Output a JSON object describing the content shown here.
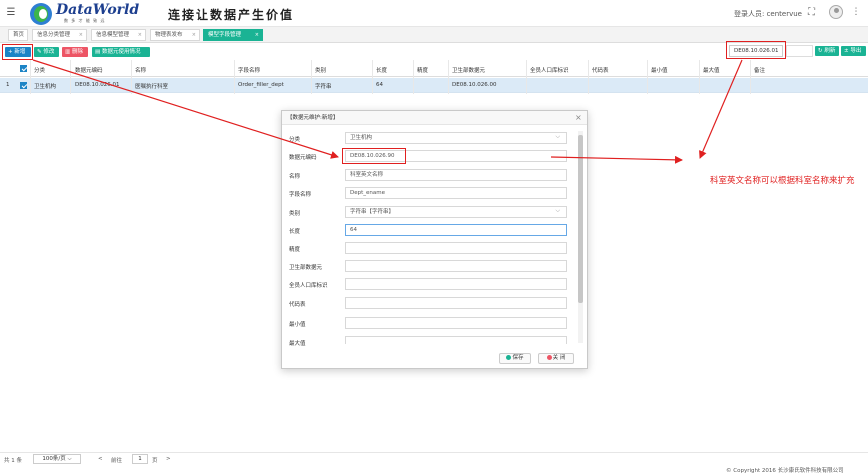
{
  "header": {
    "menu_icon": "hamburger-icon",
    "logo_text": "DataWorld",
    "logo_sub": "数 多 才 能 致 远",
    "slogan": "连接让数据产生价值",
    "login_label": "登录人员: centervue",
    "fullscreen_icon": "fullscreen-icon",
    "more_icon": "more-vertical-icon"
  },
  "tabs": [
    {
      "label": "首页"
    },
    {
      "label": "信息分类管理"
    },
    {
      "label": "信息模型管理"
    },
    {
      "label": "物理表发布"
    },
    {
      "label": "模型字段管理",
      "active": true
    }
  ],
  "toolbar": {
    "add": "新增",
    "edit": "修改",
    "delete": "删除",
    "usage": "数据元使用情况",
    "search_value": "DE08.10.026.01",
    "refresh": "刷新",
    "export": "导出"
  },
  "table": {
    "columns": [
      "分类",
      "数据元编码",
      "名称",
      "字段名称",
      "类别",
      "长度",
      "精度",
      "卫生部数据元",
      "全员人口库标识",
      "代码表",
      "最小值",
      "最大值",
      "备注"
    ],
    "rows": [
      {
        "index": "1",
        "cells": [
          "卫生机构",
          "DE08.10.026.01",
          "医嘱执行科室",
          "Order_filler_dept",
          "字符串",
          "64",
          "",
          "DE08.10.026.00",
          "",
          "",
          "",
          "",
          ""
        ]
      }
    ]
  },
  "dialog": {
    "title": "【数据元维护:新增】",
    "fields": [
      {
        "label": "分类",
        "value": "卫生机构",
        "select": true
      },
      {
        "label": "数据元编码",
        "value": "DE08.10.026.90"
      },
      {
        "label": "名称",
        "value": "科室英文名称"
      },
      {
        "label": "字段名称",
        "value": "Dept_ename"
      },
      {
        "label": "类别",
        "value": "字符串【字符串】",
        "select": true
      },
      {
        "label": "长度",
        "value": "64"
      },
      {
        "label": "精度",
        "value": ""
      },
      {
        "label": "卫生部数据元",
        "value": ""
      },
      {
        "label": "全员人口库标识",
        "value": ""
      },
      {
        "label": "代码表",
        "value": ""
      },
      {
        "label": "最小值",
        "value": ""
      },
      {
        "label": "最大值",
        "value": ""
      }
    ],
    "save": "保存",
    "close": "关 闭"
  },
  "annotation": "科室英文名称可以根据科室名称来扩充",
  "pager": {
    "total": "共 1 条",
    "page_size": "100条/页",
    "prev": "<",
    "goto": "前往",
    "page": "1",
    "page_suffix": "页",
    "next": ">"
  },
  "copyright": "© Copyright 2016 长沙康氏软件科技有限公司",
  "colors": {
    "accent_green": "#1ab394",
    "accent_blue": "#1c84c6",
    "danger": "#ed5565",
    "annotation_red": "#e02020",
    "row_selected": "#dbeaf7"
  }
}
